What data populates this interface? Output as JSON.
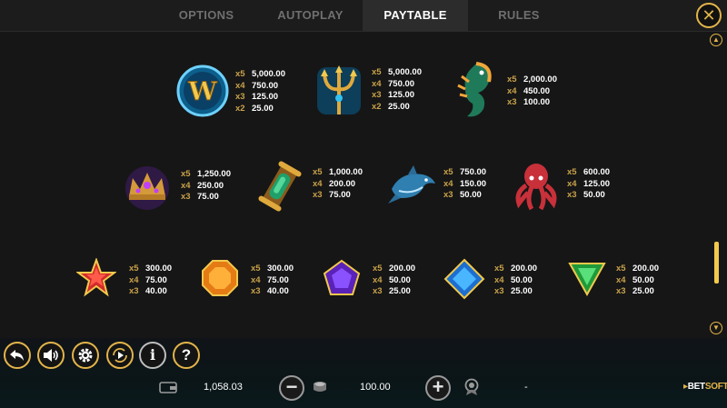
{
  "tabs": [
    {
      "label": "OPTIONS"
    },
    {
      "label": "AUTOPLAY"
    },
    {
      "label": "PAYTABLE"
    },
    {
      "label": "RULES"
    }
  ],
  "active_tab": "PAYTABLE",
  "close_icon": "close-icon",
  "paytable": {
    "wild": {
      "name": "wild-w-symbol",
      "pays": [
        {
          "mult": "x5",
          "val": "5,000.00"
        },
        {
          "mult": "x4",
          "val": "750.00"
        },
        {
          "mult": "x3",
          "val": "125.00"
        },
        {
          "mult": "x2",
          "val": "25.00"
        }
      ]
    },
    "trident": {
      "name": "trident-symbol",
      "pays": [
        {
          "mult": "x5",
          "val": "5,000.00"
        },
        {
          "mult": "x4",
          "val": "750.00"
        },
        {
          "mult": "x3",
          "val": "125.00"
        },
        {
          "mult": "x2",
          "val": "25.00"
        }
      ]
    },
    "seahorse": {
      "name": "seahorse-symbol",
      "pays": [
        {
          "mult": "x5",
          "val": "2,000.00"
        },
        {
          "mult": "x4",
          "val": "450.00"
        },
        {
          "mult": "x3",
          "val": "100.00"
        }
      ]
    },
    "crown": {
      "name": "crown-symbol",
      "pays": [
        {
          "mult": "x5",
          "val": "1,250.00"
        },
        {
          "mult": "x4",
          "val": "250.00"
        },
        {
          "mult": "x3",
          "val": "75.00"
        }
      ]
    },
    "scroll": {
      "name": "scroll-symbol",
      "pays": [
        {
          "mult": "x5",
          "val": "1,000.00"
        },
        {
          "mult": "x4",
          "val": "200.00"
        },
        {
          "mult": "x3",
          "val": "75.00"
        }
      ]
    },
    "dolphin": {
      "name": "dolphin-symbol",
      "pays": [
        {
          "mult": "x5",
          "val": "750.00"
        },
        {
          "mult": "x4",
          "val": "150.00"
        },
        {
          "mult": "x3",
          "val": "50.00"
        }
      ]
    },
    "octopus": {
      "name": "octopus-symbol",
      "pays": [
        {
          "mult": "x5",
          "val": "600.00"
        },
        {
          "mult": "x4",
          "val": "125.00"
        },
        {
          "mult": "x3",
          "val": "50.00"
        }
      ]
    },
    "star": {
      "name": "red-star-gem-symbol",
      "pays": [
        {
          "mult": "x5",
          "val": "300.00"
        },
        {
          "mult": "x4",
          "val": "75.00"
        },
        {
          "mult": "x3",
          "val": "40.00"
        }
      ]
    },
    "orange": {
      "name": "orange-octagon-gem-symbol",
      "pays": [
        {
          "mult": "x5",
          "val": "300.00"
        },
        {
          "mult": "x4",
          "val": "75.00"
        },
        {
          "mult": "x3",
          "val": "40.00"
        }
      ]
    },
    "purple": {
      "name": "purple-pentagon-gem-symbol",
      "pays": [
        {
          "mult": "x5",
          "val": "200.00"
        },
        {
          "mult": "x4",
          "val": "50.00"
        },
        {
          "mult": "x3",
          "val": "25.00"
        }
      ]
    },
    "blue": {
      "name": "blue-diamond-gem-symbol",
      "pays": [
        {
          "mult": "x5",
          "val": "200.00"
        },
        {
          "mult": "x4",
          "val": "50.00"
        },
        {
          "mult": "x3",
          "val": "25.00"
        }
      ]
    },
    "green": {
      "name": "green-triangle-gem-symbol",
      "pays": [
        {
          "mult": "x5",
          "val": "200.00"
        },
        {
          "mult": "x4",
          "val": "50.00"
        },
        {
          "mult": "x3",
          "val": "25.00"
        }
      ]
    }
  },
  "controls": {
    "back_icon": "back-arrow-icon",
    "sound_icon": "speaker-icon",
    "settings_icon": "gear-icon",
    "autoplay_icon": "autoplay-icon",
    "info_label": "i",
    "help_label": "?"
  },
  "status": {
    "balance": "1,058.03",
    "bet": "100.00",
    "win": "-",
    "minus_label": "−",
    "plus_label": "+"
  },
  "brand": {
    "prefix": "BET",
    "suffix": "SOFT"
  },
  "colors": {
    "accent": "#e3b44a",
    "background": "#161616",
    "tab_active": "#2c2c2c"
  }
}
